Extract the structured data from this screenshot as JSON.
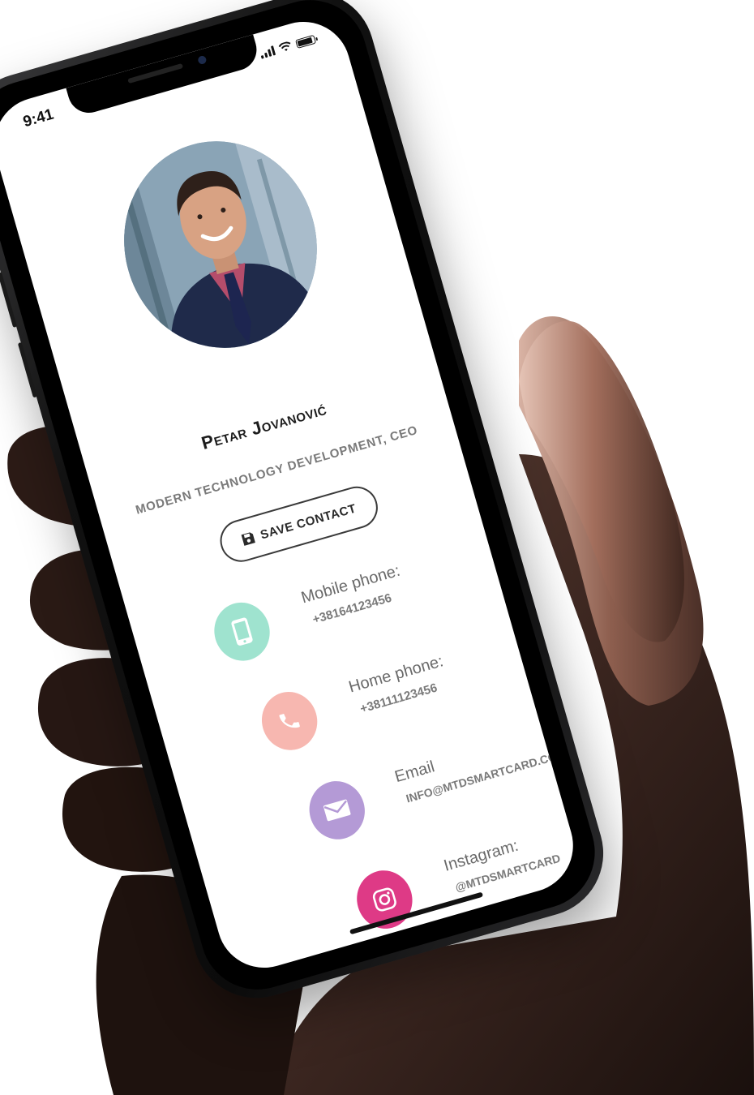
{
  "status_bar": {
    "time": "9:41"
  },
  "profile": {
    "name": "Petar Jovanović",
    "title": "MODERN TECHNOLOGY DEVELOPMENT, CEO"
  },
  "save_button": {
    "label": "SAVE CONTACT",
    "icon": "floppy-disk-icon"
  },
  "contacts": [
    {
      "label": "Mobile phone:",
      "value": "+38164123456",
      "icon": "mobile-phone-icon",
      "color": "#9fe3cf"
    },
    {
      "label": "Home phone:",
      "value": "+38111123456",
      "icon": "telephone-icon",
      "color": "#f7b7b0"
    },
    {
      "label": "Email",
      "value": "INFO@MTDSMARTCARD.COM",
      "icon": "envelope-icon",
      "color": "#b49ad6"
    },
    {
      "label": "Instagram:",
      "value": "@MTDSMARTCARD",
      "icon": "instagram-icon",
      "color": "#de3a86"
    }
  ],
  "colors": {
    "text_dark": "#1c1c1c",
    "text_muted": "#7a7a7a",
    "mobile": "#9fe3cf",
    "home": "#f7b7b0",
    "email": "#b49ad6",
    "instagram": "#de3a86"
  }
}
